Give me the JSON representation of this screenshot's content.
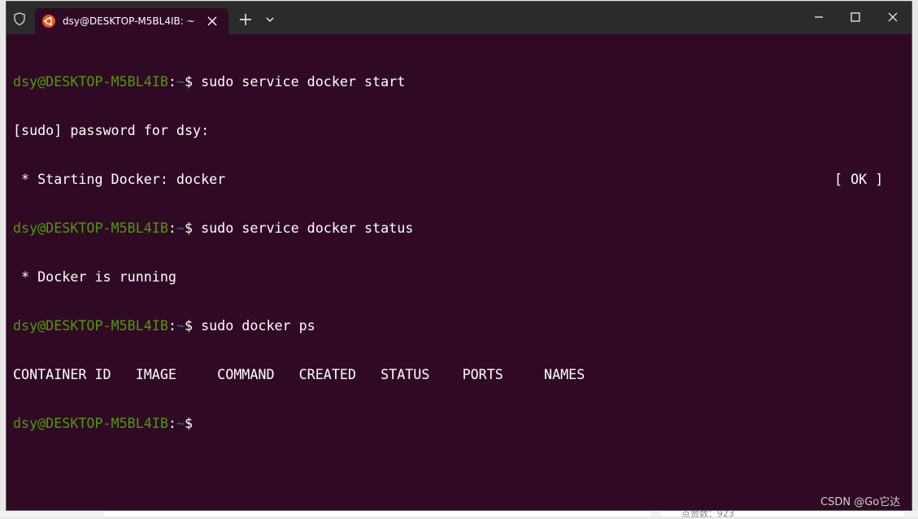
{
  "tab": {
    "title": "dsy@DESKTOP-M5BL4IB: ~"
  },
  "prompt": {
    "user_host": "dsy@DESKTOP-M5BL4IB",
    "sep": ":",
    "path": "~",
    "symbol": "$"
  },
  "terminal": {
    "cmd1": " sudo service docker start",
    "out1": "[sudo] password for dsy:",
    "out2": " * Starting Docker: docker",
    "out2_status": "[ OK ]",
    "cmd2": " sudo service docker status",
    "out3": " * Docker is running",
    "cmd3": " sudo docker ps",
    "ps_header": "CONTAINER ID   IMAGE     COMMAND   CREATED   STATUS    PORTS     NAMES",
    "cmd4": ""
  },
  "watermark": "CSDN @Go它达",
  "background_snippet": "点赞数：923",
  "colors": {
    "terminal_bg": "#300a24",
    "user_host": "#4e9a06",
    "path": "#3465a4",
    "titlebar": "#2b2b2b"
  }
}
